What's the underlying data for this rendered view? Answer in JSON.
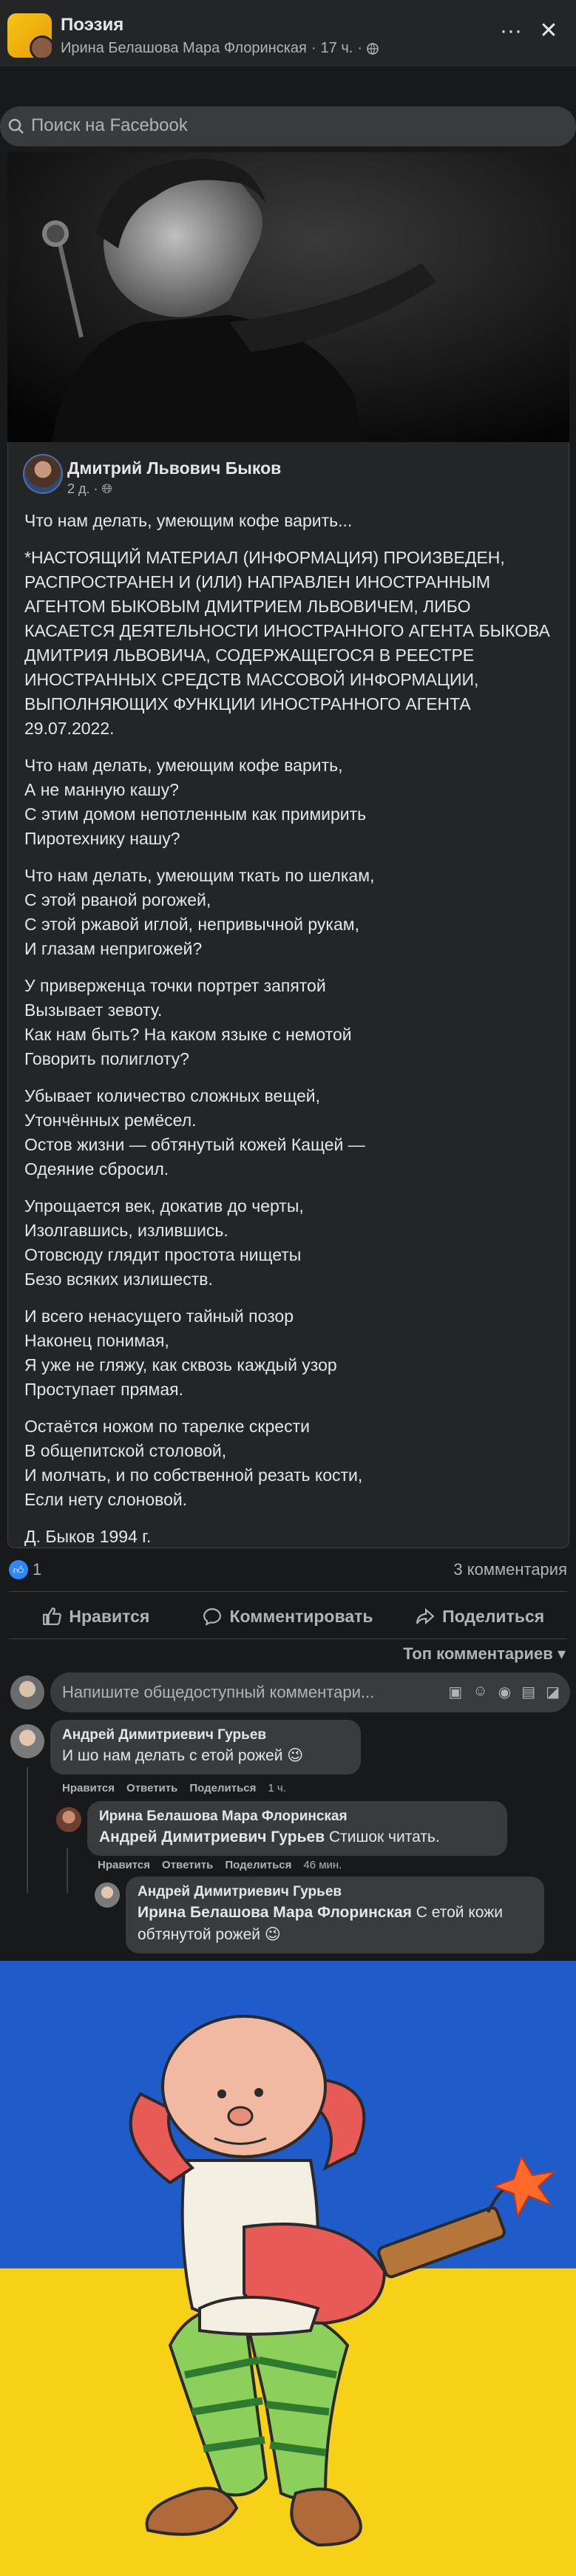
{
  "header": {
    "group_name": "Поэзия",
    "poster": "Ирина Белашова Мара Флоринская",
    "time": "17 ч.",
    "more_icon": "more-icon",
    "close_icon": "close-icon"
  },
  "search": {
    "placeholder": "Поиск на Facebook"
  },
  "shared_post": {
    "author": "Дмитрий Львович Быков",
    "time": "2 д.",
    "paragraphs": [
      "Что нам делать, умеющим кофе варить...",
      "*НАСТОЯЩИЙ МАТЕРИАЛ (ИНФОРМАЦИЯ) ПРОИЗВЕДЕН, РАСПРОСТРАНЕН И (ИЛИ) НАПРАВЛЕН ИНОСТРАННЫМ АГЕНТОМ БЫКОВЫМ ДМИТРИЕМ ЛЬВОВИЧЕМ, ЛИБО КАСАЕТСЯ ДЕЯТЕЛЬНОСТИ ИНОСТРАННОГО АГЕНТА БЫКОВА ДМИТРИЯ ЛЬВОВИЧА, СОДЕРЖАЩЕГОСЯ В РЕЕСТРЕ ИНОСТРАННЫХ СРЕДСТВ МАССОВОЙ ИНФОРМАЦИИ, ВЫПОЛНЯЮЩИХ ФУНКЦИИ ИНОСТРАННОГО АГЕНТА 29.07.2022.",
      "Что нам делать, умеющим кофе варить,\nА не манную кашу?\nС этим домом непотленным как примирить\nПиротехнику нашу?",
      "Что нам делать, умеющим ткать по шелкам,\nС этой рваной рогожей,\nС этой ржавой иглой, непривычной рукам,\nИ глазам непригожей?",
      "У приверженца точки портрет запятой\nВызывает зевоту.\nКак нам быть? На каком языке с немотой\nГоворить полиглоту?",
      "Убывает количество сложных вещей,\nУтончённых ремёсел.\nОстов жизни — обтянутый кожей Кащей —\nОдеяние сбросил.",
      "Упрощается век, докатив до черты,\nИзолгавшись, излившись.\nОтовсюду глядит простота нищеты\nБезо всяких излишеств.",
      "И всего ненасущего тайный позор\nНаконец понимая,\nЯ уже не гляжу, как сквозь каждый узор\nПроступает прямая.",
      "Остаётся ножом по тарелке скрести\nВ общепитской столовой,\nИ молчать, и по собственной резать кости,\nЕсли нету слоновой.",
      "Д. Быков 1994 г."
    ]
  },
  "stats": {
    "likes": "1",
    "comments": "3 комментария"
  },
  "actions": {
    "like": "Нравится",
    "comment": "Комментировать",
    "share": "Поделиться"
  },
  "sort_label": "Топ комментариев",
  "composer": {
    "placeholder": "Напишите общедоступный комментари..."
  },
  "comments": [
    {
      "name": "Андрей Димитриевич Гурьев",
      "mention": "",
      "text": "И шо нам делать с етой рожей 😉",
      "actions": [
        "Нравится",
        "Ответить",
        "Поделиться"
      ],
      "time": "1 ч."
    },
    {
      "name": "Ирина Белашова Мара Флоринская",
      "mention": "Андрей Димитриевич Гурьев",
      "text": "Стишок читать.",
      "actions": [
        "Нравится",
        "Ответить",
        "Поделиться"
      ],
      "time": "46 мин."
    },
    {
      "name": "Андрей Димитриевич Гурьев",
      "mention": "Ирина Белашова Мара Флоринская",
      "text": "С етой кожи обтянутой рожей 😉",
      "actions": [],
      "time": ""
    }
  ],
  "colors": {
    "background": "#18191a",
    "card": "#242526",
    "accent": "#2d88ff",
    "flag_blue": "#1f5bc9",
    "flag_yellow": "#f7d117"
  }
}
